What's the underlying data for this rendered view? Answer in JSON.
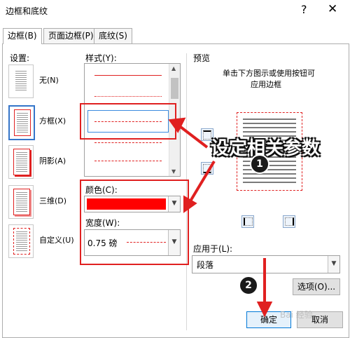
{
  "dialog": {
    "title": "边框和底纹",
    "help": "?",
    "close": "✕"
  },
  "tabs": [
    {
      "label": "边框(B)",
      "active": true
    },
    {
      "label": "页面边框(P)",
      "active": false
    },
    {
      "label": "底纹(S)",
      "active": false
    }
  ],
  "settings": {
    "heading": "设置:",
    "items": [
      {
        "label": "无(N)",
        "selected": false
      },
      {
        "label": "方框(X)",
        "selected": true
      },
      {
        "label": "阴影(A)",
        "selected": false
      },
      {
        "label": "三维(D)",
        "selected": false
      },
      {
        "label": "自定义(U)",
        "selected": false
      }
    ]
  },
  "style": {
    "heading": "样式(Y):"
  },
  "color": {
    "heading": "颜色(C):",
    "value": "#ff0000"
  },
  "width": {
    "heading": "宽度(W):",
    "value": "0.75 磅"
  },
  "preview": {
    "heading": "预览",
    "instruction_line1": "单击下方图示或使用按钮可",
    "instruction_line2": "应用边框"
  },
  "apply_to": {
    "heading": "应用于(L):",
    "value": "段落"
  },
  "buttons": {
    "options": "选项(O)...",
    "ok": "确定",
    "cancel": "取消"
  },
  "annotation": {
    "callout": "设定相关参数",
    "step1": "1",
    "step2": "2",
    "color": "#e02020"
  },
  "watermark": "Bai 经验"
}
